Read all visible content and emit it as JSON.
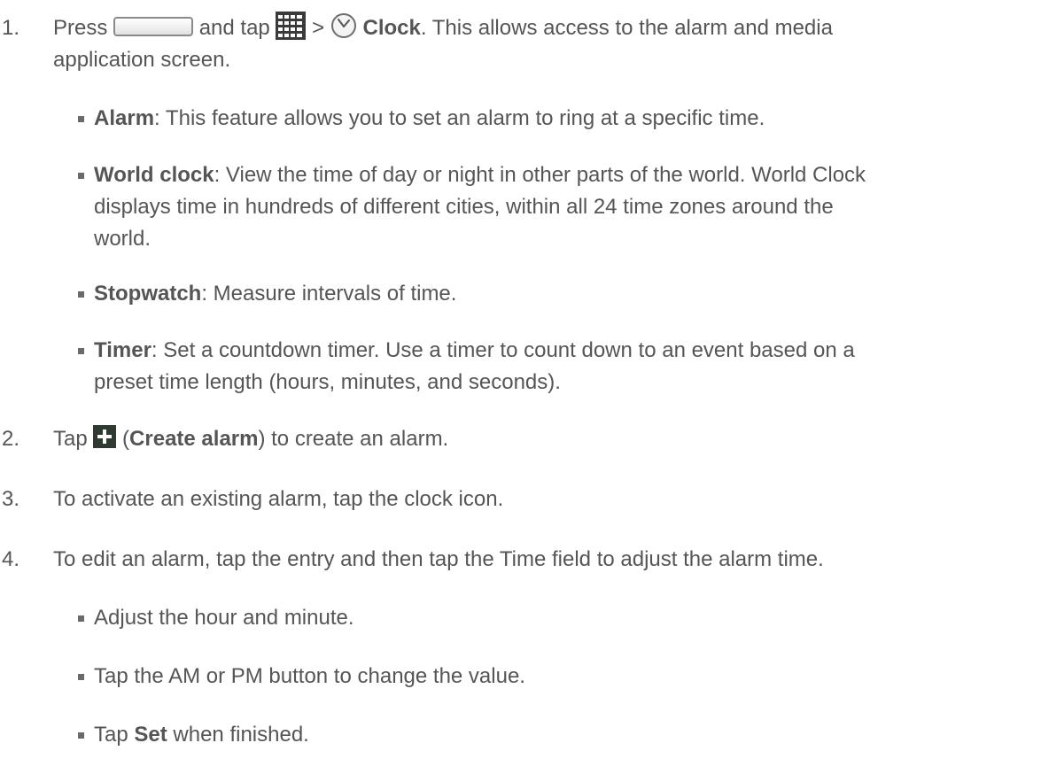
{
  "steps": [
    {
      "number": "1.",
      "t1": "Press",
      "t2": "and tap",
      "t3": ">",
      "t4": "Clock",
      "t5": ". This allows access to the alarm and media",
      "line2": "application screen.",
      "icons": [
        "home-key-icon",
        "applications-grid-icon",
        "clock-icon"
      ]
    },
    {
      "number": "2.",
      "t1": "Tap",
      "t2": "(",
      "t3": "Create alarm",
      "t4": ") to create an alarm.",
      "icons": [
        "create-alarm-plus-icon"
      ]
    },
    {
      "number": "3.",
      "text": "To activate an existing alarm, tap the clock icon."
    },
    {
      "number": "4.",
      "text": "To edit an alarm, tap the entry and then tap the Time field to adjust the alarm time."
    }
  ],
  "step1_bullets": [
    {
      "term": "Alarm",
      "lines": [
        ": This feature allows you to set an alarm to ring at a specific time."
      ]
    },
    {
      "term": "World clock",
      "lines": [
        ": View the time of day or night in other parts of the world. World Clock",
        "displays time in hundreds of different cities, within all 24 time zones around the",
        "world."
      ]
    },
    {
      "term": "Stopwatch",
      "lines": [
        ": Measure intervals of time."
      ]
    },
    {
      "term": "Timer",
      "lines": [
        ": Set a countdown timer. Use a timer to count down to an event based on a",
        "preset time length (hours, minutes, and seconds)."
      ]
    }
  ],
  "step4_bullets": [
    {
      "text": "Adjust the hour and minute."
    },
    {
      "text": "Tap the AM or PM button to change the value."
    },
    {
      "pre": "Tap",
      "term": "Set",
      "post": "when finished."
    }
  ],
  "colors": {
    "text": "#555555",
    "icon_dark": "#3a3a3a",
    "icon_green": "#2e7d32"
  }
}
